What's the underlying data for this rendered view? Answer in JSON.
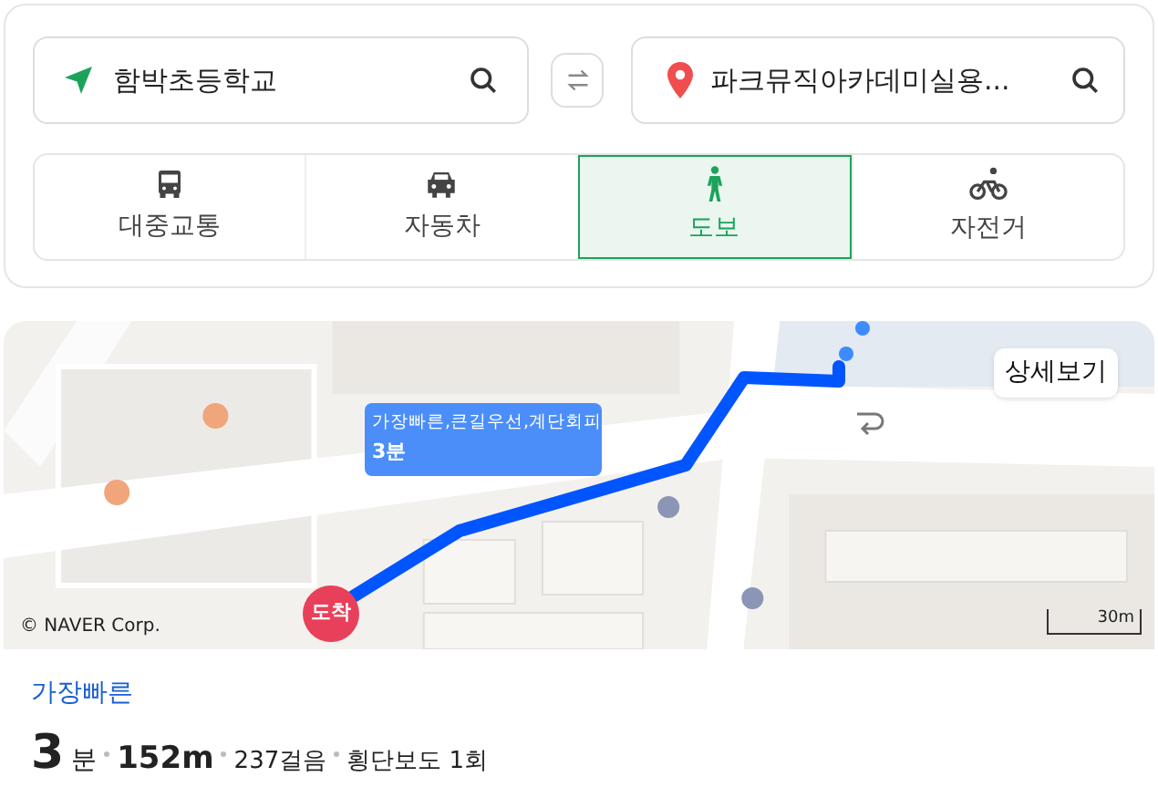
{
  "search": {
    "origin": {
      "value": "함박초등학교"
    },
    "destination": {
      "value": "파크뮤직아카데미실용..."
    }
  },
  "modes": [
    {
      "label": "대중교통",
      "kind": "bus",
      "selected": false
    },
    {
      "label": "자동차",
      "kind": "car",
      "selected": false
    },
    {
      "label": "도보",
      "kind": "walk",
      "selected": true
    },
    {
      "label": "자전거",
      "kind": "bike",
      "selected": false
    }
  ],
  "map": {
    "kind": "picture",
    "callout": {
      "title": "가장빠른,큰길우선,계단회피",
      "time": "3분"
    },
    "detail_button": "상세보기",
    "arrival_marker": "도착",
    "copyright": "© NAVER Corp.",
    "scale": "30m"
  },
  "route": {
    "title": "가장빠른",
    "minutes": "3",
    "minutes_unit": "분",
    "distance": "152m",
    "steps": "237걸음",
    "crossings": "횡단보도 1회"
  }
}
